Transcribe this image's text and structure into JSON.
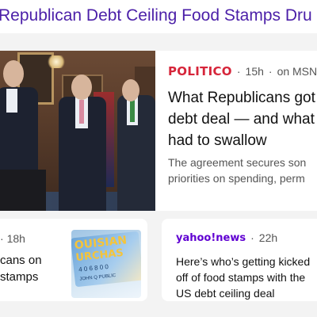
{
  "header": {
    "title": "Republican Debt Ceiling Food Stamps Dru"
  },
  "main_story": {
    "source": "POLITICO",
    "age": "15h",
    "via": "on MSN",
    "headline_lines": [
      "What Republicans got",
      "debt deal — and what",
      "had to swallow"
    ],
    "snippet_lines": [
      "The agreement secures son",
      "priorities on spending, perm"
    ]
  },
  "card_left": {
    "age": "18h",
    "headline_lines": [
      "cans on",
      "stamps"
    ],
    "image_text": [
      "OUISIAN",
      "URCHAS",
      "4 0 6 8 0 0",
      "JOHN Q PUBLIC"
    ]
  },
  "card_right": {
    "source": "yahoo!news",
    "age": "22h",
    "headline_lines": [
      "Here’s who’s getting kicked",
      "off of food stamps with the",
      "US debt ceiling deal"
    ]
  },
  "colors": {
    "header_title": "#4b1fa8",
    "politico_red": "#d6253a",
    "yahoo_purple": "#6001d2",
    "page_bg": "#f3f3f3"
  }
}
